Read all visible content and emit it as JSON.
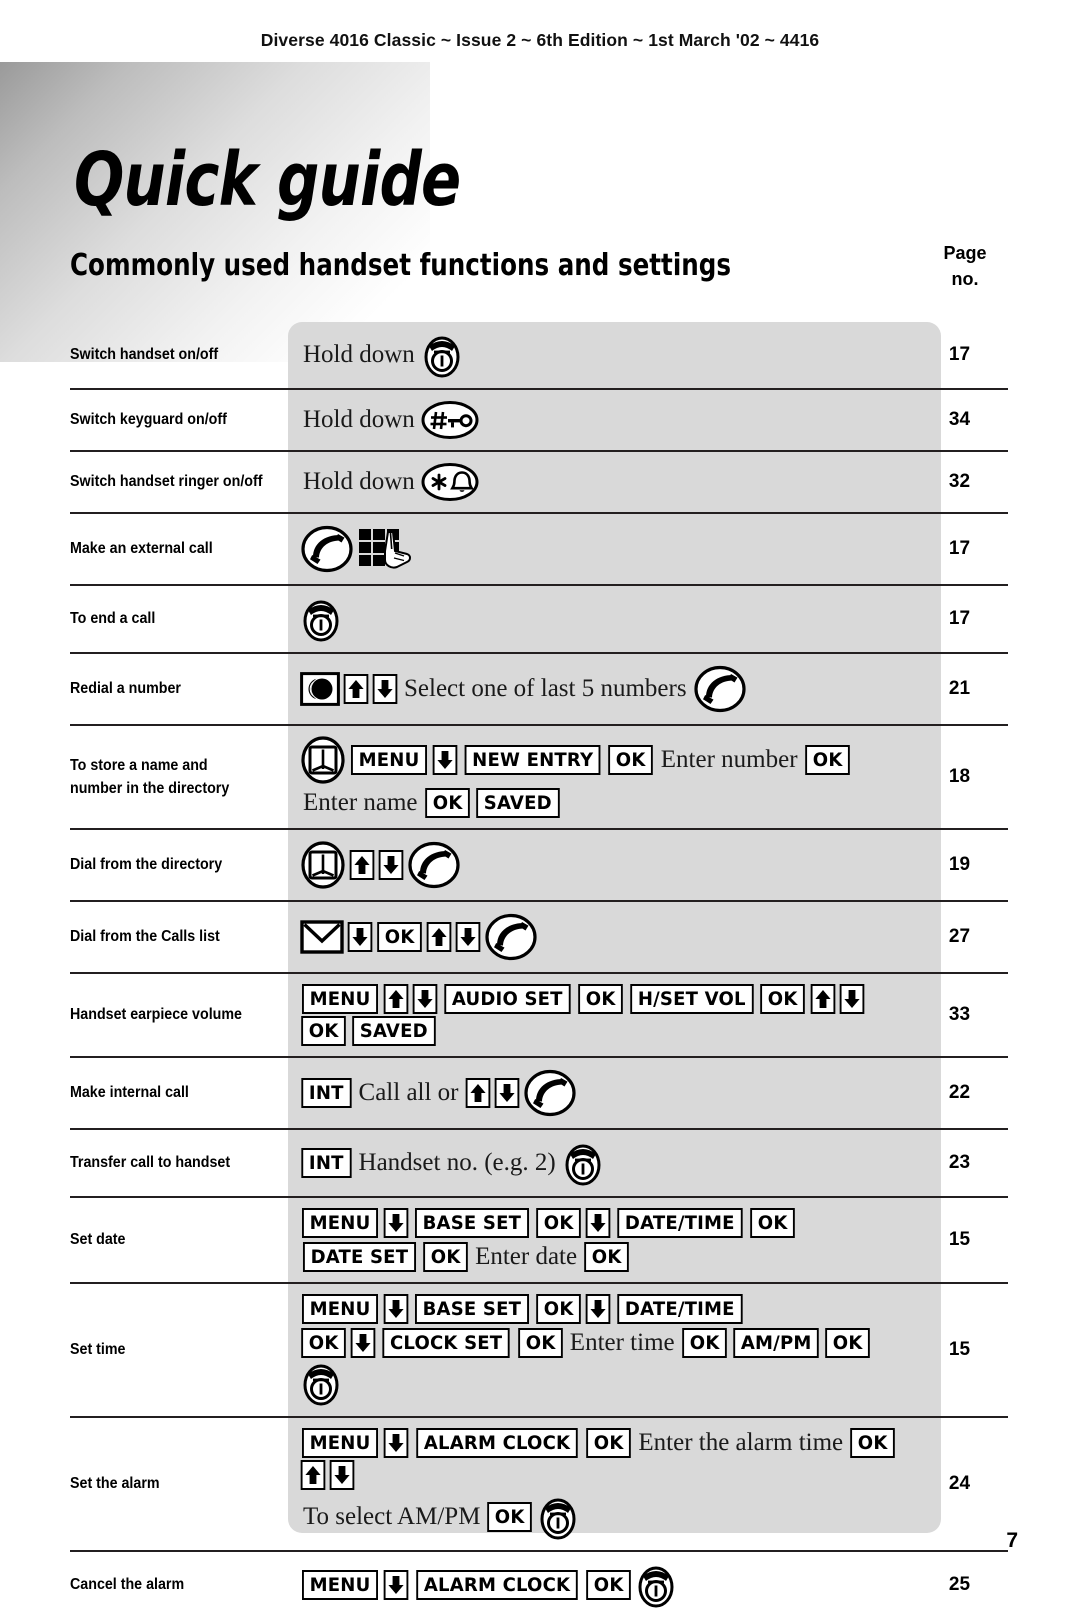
{
  "header": {
    "running_head": "Diverse 4016 Classic ~ Issue 2 ~ 6th Edition ~ 1st March '02 ~ 4416"
  },
  "title": "Quick guide",
  "subtitle": "Commonly used handset functions and settings",
  "page_column_header": {
    "line1": "Page",
    "line2": "no."
  },
  "footer": {
    "page_number": "7"
  },
  "colors": {
    "panel": "#d9d9d9",
    "rule": "#231f20",
    "text": "#000000"
  },
  "rows": [
    {
      "label": "Switch handset on/off",
      "page": "17",
      "sequence": [
        {
          "type": "text",
          "value": "Hold down"
        },
        {
          "type": "icon",
          "name": "end-call-icon"
        }
      ]
    },
    {
      "label": "Switch keyguard on/off",
      "page": "34",
      "sequence": [
        {
          "type": "text",
          "value": "Hold down"
        },
        {
          "type": "icon",
          "name": "keyguard-icon"
        }
      ]
    },
    {
      "label": "Switch handset ringer on/off",
      "page": "32",
      "sequence": [
        {
          "type": "text",
          "value": "Hold down"
        },
        {
          "type": "icon",
          "name": "ringer-icon"
        }
      ]
    },
    {
      "label": "Make an external call",
      "page": "17",
      "sequence": [
        {
          "type": "icon",
          "name": "talk-icon"
        },
        {
          "type": "icon",
          "name": "keypad-hand-icon"
        }
      ]
    },
    {
      "label": "To end a call",
      "page": "17",
      "sequence": [
        {
          "type": "icon",
          "name": "end-call-icon"
        }
      ]
    },
    {
      "label": "Redial a number",
      "page": "21",
      "sequence": [
        {
          "type": "icon",
          "name": "redial-icon"
        },
        {
          "type": "key",
          "value": "up-arrow"
        },
        {
          "type": "key",
          "value": "down-arrow"
        },
        {
          "type": "text",
          "value": "Select one of last 5 numbers"
        },
        {
          "type": "icon",
          "name": "talk-icon"
        }
      ]
    },
    {
      "label": "To store a name and number in  the directory",
      "page": "18",
      "sequence": [
        {
          "type": "icon",
          "name": "directory-icon"
        },
        {
          "type": "key",
          "value": "MENU"
        },
        {
          "type": "key",
          "value": "down-arrow"
        },
        {
          "type": "key",
          "value": "NEW ENTRY"
        },
        {
          "type": "key",
          "value": "OK"
        },
        {
          "type": "text",
          "value": "Enter number"
        },
        {
          "type": "key",
          "value": "OK"
        },
        {
          "type": "break"
        },
        {
          "type": "text",
          "value": "Enter name"
        },
        {
          "type": "key",
          "value": "OK"
        },
        {
          "type": "key",
          "value": "SAVED"
        }
      ]
    },
    {
      "label": "Dial from the directory",
      "page": "19",
      "sequence": [
        {
          "type": "icon",
          "name": "directory-icon"
        },
        {
          "type": "key",
          "value": "up-arrow"
        },
        {
          "type": "key",
          "value": "down-arrow"
        },
        {
          "type": "icon",
          "name": "talk-icon"
        }
      ]
    },
    {
      "label": "Dial from the Calls list",
      "page": "27",
      "sequence": [
        {
          "type": "icon",
          "name": "calls-list-icon"
        },
        {
          "type": "key",
          "value": "down-arrow"
        },
        {
          "type": "key",
          "value": "OK"
        },
        {
          "type": "key",
          "value": "up-arrow"
        },
        {
          "type": "key",
          "value": "down-arrow"
        },
        {
          "type": "icon",
          "name": "talk-icon"
        }
      ]
    },
    {
      "label": "Handset earpiece volume",
      "page": "33",
      "sequence": [
        {
          "type": "key",
          "value": "MENU"
        },
        {
          "type": "key",
          "value": "up-arrow"
        },
        {
          "type": "key",
          "value": "down-arrow"
        },
        {
          "type": "key",
          "value": "AUDIO SET"
        },
        {
          "type": "key",
          "value": "OK"
        },
        {
          "type": "key",
          "value": "H/SET VOL"
        },
        {
          "type": "key",
          "value": "OK"
        },
        {
          "type": "key",
          "value": "up-arrow"
        },
        {
          "type": "key",
          "value": "down-arrow"
        },
        {
          "type": "key",
          "value": "OK"
        },
        {
          "type": "key",
          "value": "SAVED"
        }
      ]
    },
    {
      "label": "Make internal call",
      "page": "22",
      "sequence": [
        {
          "type": "key",
          "value": "INT"
        },
        {
          "type": "text",
          "value": "Call all or"
        },
        {
          "type": "key",
          "value": "up-arrow"
        },
        {
          "type": "key",
          "value": "down-arrow"
        },
        {
          "type": "icon",
          "name": "talk-icon"
        }
      ]
    },
    {
      "label": "Transfer call to handset",
      "page": "23",
      "sequence": [
        {
          "type": "key",
          "value": "INT"
        },
        {
          "type": "text",
          "value": "Handset no. (e.g. 2)"
        },
        {
          "type": "icon",
          "name": "end-call-icon"
        }
      ]
    },
    {
      "label": "Set date",
      "page": "15",
      "sequence": [
        {
          "type": "key",
          "value": "MENU"
        },
        {
          "type": "key",
          "value": "down-arrow"
        },
        {
          "type": "key",
          "value": "BASE SET"
        },
        {
          "type": "key",
          "value": "OK"
        },
        {
          "type": "key",
          "value": "down-arrow"
        },
        {
          "type": "key",
          "value": "DATE/TIME"
        },
        {
          "type": "key",
          "value": "OK"
        },
        {
          "type": "break"
        },
        {
          "type": "key",
          "value": "DATE SET"
        },
        {
          "type": "key",
          "value": "OK"
        },
        {
          "type": "text",
          "value": "Enter date"
        },
        {
          "type": "key",
          "value": "OK"
        }
      ]
    },
    {
      "label": "Set time",
      "page": "15",
      "sequence": [
        {
          "type": "key",
          "value": "MENU"
        },
        {
          "type": "key",
          "value": "down-arrow"
        },
        {
          "type": "key",
          "value": "BASE SET"
        },
        {
          "type": "key",
          "value": "OK"
        },
        {
          "type": "key",
          "value": "down-arrow"
        },
        {
          "type": "key",
          "value": "DATE/TIME"
        },
        {
          "type": "break"
        },
        {
          "type": "key",
          "value": "OK"
        },
        {
          "type": "key",
          "value": "down-arrow"
        },
        {
          "type": "key",
          "value": "CLOCK SET"
        },
        {
          "type": "key",
          "value": "OK"
        },
        {
          "type": "text",
          "value": "Enter time"
        },
        {
          "type": "key",
          "value": "OK"
        },
        {
          "type": "key",
          "value": "AM/PM"
        },
        {
          "type": "key",
          "value": "OK"
        },
        {
          "type": "icon",
          "name": "end-call-icon"
        }
      ]
    },
    {
      "label": "Set the alarm",
      "page": "24",
      "sequence": [
        {
          "type": "key",
          "value": "MENU"
        },
        {
          "type": "key",
          "value": "down-arrow"
        },
        {
          "type": "key",
          "value": "ALARM CLOCK"
        },
        {
          "type": "key",
          "value": "OK"
        },
        {
          "type": "text",
          "value": "Enter the alarm time"
        },
        {
          "type": "key",
          "value": "OK"
        },
        {
          "type": "key",
          "value": "up-arrow"
        },
        {
          "type": "key",
          "value": "down-arrow"
        },
        {
          "type": "break"
        },
        {
          "type": "text",
          "value": "To select AM/PM"
        },
        {
          "type": "key",
          "value": "OK"
        },
        {
          "type": "icon",
          "name": "end-call-icon"
        }
      ]
    },
    {
      "label": "Cancel the alarm",
      "page": "25",
      "sequence": [
        {
          "type": "key",
          "value": "MENU"
        },
        {
          "type": "key",
          "value": "down-arrow"
        },
        {
          "type": "key",
          "value": "ALARM CLOCK"
        },
        {
          "type": "key",
          "value": "OK"
        },
        {
          "type": "icon",
          "name": "end-call-icon"
        }
      ]
    }
  ]
}
